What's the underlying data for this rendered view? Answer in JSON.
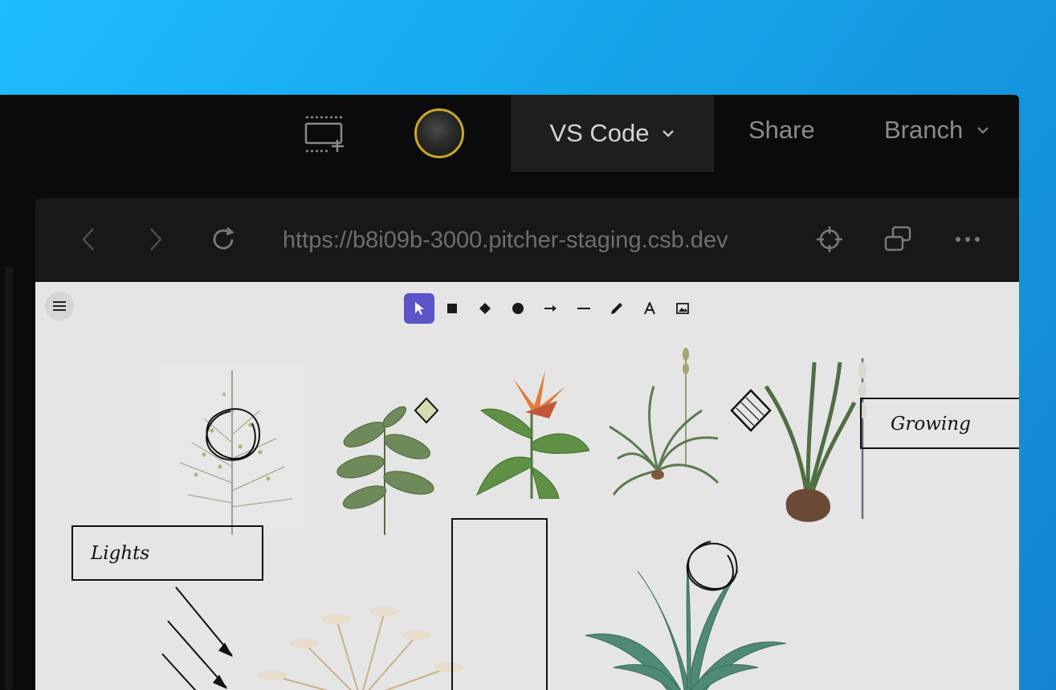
{
  "topbar": {
    "vscode_label": "VS Code",
    "share_label": "Share",
    "branch_label": "Branch"
  },
  "browser": {
    "url": "https://b8i09b-3000.pitcher-staging.csb.dev"
  },
  "canvas": {
    "labels": {
      "lights": "Lights",
      "growing": "Growing"
    },
    "toolbar": {
      "active_tool": "select",
      "tools": [
        "select",
        "rectangle",
        "diamond",
        "ellipse",
        "arrow",
        "line",
        "pencil",
        "text",
        "image"
      ]
    }
  },
  "colors": {
    "accent": "#5b55c9",
    "avatar_ring": "#c9a826",
    "background_gradient_start": "#1fbcff",
    "background_gradient_end": "#1484d2"
  }
}
